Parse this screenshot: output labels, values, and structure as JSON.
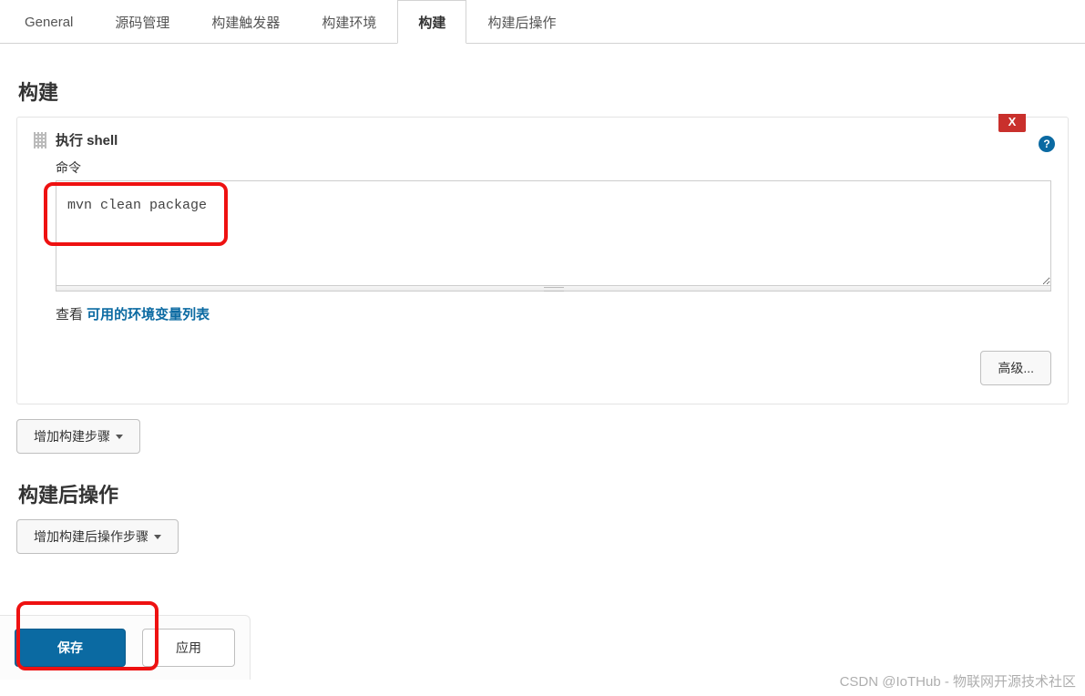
{
  "tabs": [
    {
      "label": "General",
      "active": false
    },
    {
      "label": "源码管理",
      "active": false
    },
    {
      "label": "构建触发器",
      "active": false
    },
    {
      "label": "构建环境",
      "active": false
    },
    {
      "label": "构建",
      "active": true
    },
    {
      "label": "构建后操作",
      "active": false
    }
  ],
  "sections": {
    "build": {
      "title": "构建",
      "step": {
        "title": "执行 shell",
        "delete_label": "X",
        "help_label": "?",
        "command_label": "命令",
        "command_value": "mvn clean package",
        "hint_prefix": "查看 ",
        "hint_link": "可用的环境变量列表",
        "advanced_label": "高级..."
      },
      "add_step_label": "增加构建步骤"
    },
    "post_build": {
      "title": "构建后操作",
      "add_step_label": "增加构建后操作步骤"
    }
  },
  "footer": {
    "save_label": "保存",
    "apply_label": "应用"
  },
  "watermark": "CSDN @IoTHub - 物联网开源技术社区"
}
